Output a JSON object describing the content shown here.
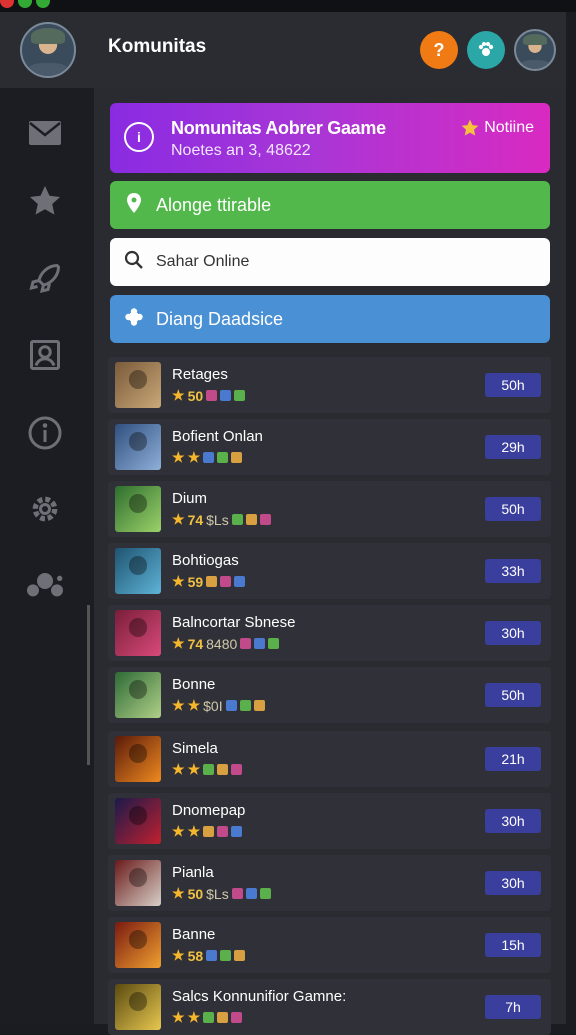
{
  "header": {
    "title": "Komunitas",
    "help_label": "?",
    "colors": {
      "help": "#f07b14",
      "apps": "#2aa7a6"
    }
  },
  "sidebar": {
    "items": [
      {
        "icon": "mail-icon"
      },
      {
        "icon": "star-icon"
      },
      {
        "icon": "rocket-icon"
      },
      {
        "icon": "contacts-icon"
      },
      {
        "icon": "info-icon"
      },
      {
        "icon": "gear-icon"
      },
      {
        "icon": "gamepad-icon"
      }
    ]
  },
  "promo": {
    "title": "Nomunitas Aobrer Gaame",
    "subtitle": "Noetes an 3, 48622",
    "badge": "Notiine"
  },
  "actions": {
    "green_label": "Alonge ttirable",
    "search_placeholder": "Sahar Online",
    "blue_label": "Diang Daadsice"
  },
  "games": [
    {
      "name": "Retages",
      "rating": "50",
      "extra": "",
      "badge": "50h",
      "colors": [
        "#7a5a3a",
        "#c9a878"
      ]
    },
    {
      "name": "Bofient Onlan",
      "rating": "",
      "extra": "",
      "badge": "29h",
      "colors": [
        "#2f4f7f",
        "#8fb0d8"
      ]
    },
    {
      "name": "Dium",
      "rating": "74",
      "extra": "$Ls",
      "badge": "50h",
      "colors": [
        "#2e6e2e",
        "#9cd26a"
      ]
    },
    {
      "name": "Bohtiogas",
      "rating": "59",
      "extra": "",
      "badge": "33h",
      "colors": [
        "#1e5470",
        "#5fb3d8"
      ]
    },
    {
      "name": "Balncortar Sbnese",
      "rating": "74",
      "extra": "8480",
      "badge": "30h",
      "colors": [
        "#7a1e3a",
        "#d84a7a"
      ]
    },
    {
      "name": "Bonne",
      "rating": "",
      "extra": "$0I",
      "badge": "50h",
      "colors": [
        "#2e6a36",
        "#b0d088"
      ]
    },
    {
      "name": "Simela",
      "rating": "",
      "extra": "",
      "badge": "21h",
      "colors": [
        "#5a1a0a",
        "#f08a20"
      ]
    },
    {
      "name": "Dnomepap",
      "rating": "",
      "extra": "",
      "badge": "30h",
      "colors": [
        "#1a1a4a",
        "#c02030"
      ]
    },
    {
      "name": "Pianla",
      "rating": "50",
      "extra": "$Ls",
      "badge": "30h",
      "colors": [
        "#6a1a1a",
        "#d8d0c8"
      ]
    },
    {
      "name": "Banne",
      "rating": "58",
      "extra": "",
      "badge": "15h",
      "colors": [
        "#7a1a10",
        "#f0a030"
      ]
    },
    {
      "name": "Salcs Konnunifior Gamne:",
      "rating": "",
      "extra": "",
      "badge": "7h",
      "colors": [
        "#5a4a10",
        "#e8c850"
      ]
    }
  ]
}
